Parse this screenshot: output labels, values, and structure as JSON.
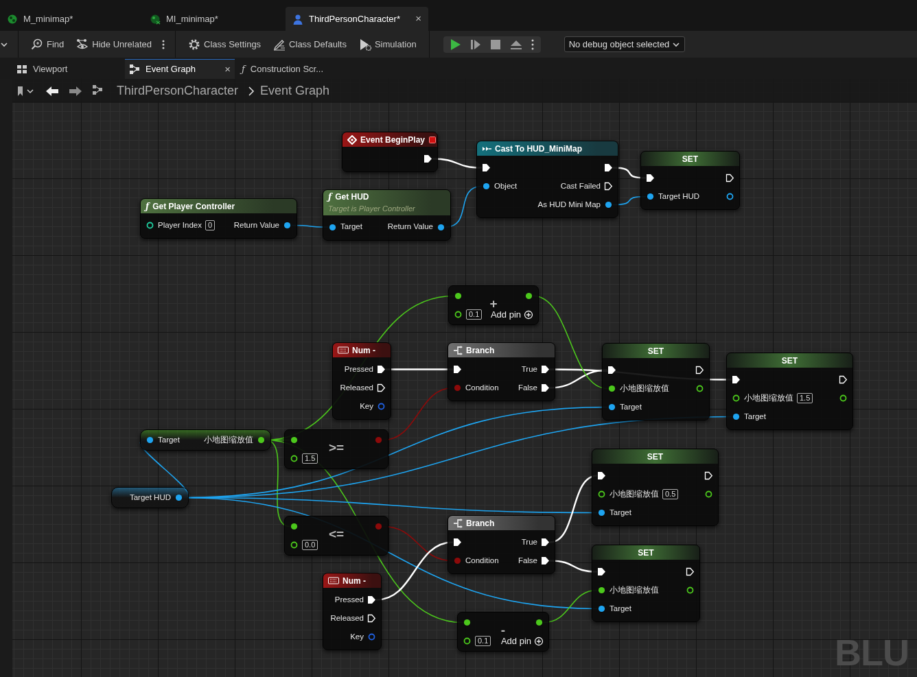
{
  "file_tabs": [
    {
      "label": "M_minimap*",
      "kind": "material",
      "selected": false
    },
    {
      "label": "MI_minimap*",
      "kind": "instance",
      "selected": false
    },
    {
      "label": "ThirdPersonCharacter*",
      "kind": "character",
      "selected": true,
      "close": "×"
    }
  ],
  "toolbar": {
    "items": [
      {
        "kind": "menu"
      },
      {
        "kind": "separator"
      },
      {
        "kind": "find",
        "label": "Find"
      },
      {
        "kind": "hide",
        "label": "Hide Unrelated"
      },
      {
        "kind": "more"
      },
      {
        "kind": "separator"
      },
      {
        "kind": "settings",
        "label": "Class Settings"
      },
      {
        "kind": "defaults",
        "label": "Class Defaults"
      },
      {
        "kind": "simulation",
        "label": "Simulation"
      },
      {
        "kind": "separator"
      }
    ],
    "debug_select": "No debug object selected"
  },
  "editor_tabs": [
    {
      "label": "Viewport",
      "kind": "viewport",
      "selected": false
    },
    {
      "label": "Event Graph",
      "kind": "graph",
      "selected": true,
      "close": "×"
    },
    {
      "label": "Construction Scr...",
      "kind": "function",
      "glyph": "ƒ",
      "selected": false
    }
  ],
  "breadcrumb": [
    "ThirdPersonCharacter",
    "Event Graph"
  ],
  "nodes": [
    {
      "kind": "event",
      "title": "Event BeginPlay",
      "rows": [
        {
          "right": {
            "kind": "exec",
            "connected": true
          }
        }
      ]
    },
    {
      "kind": "cast",
      "title": "Cast To HUD_MiniMap",
      "rows": [
        {
          "left": {
            "kind": "exec",
            "connected": true
          },
          "right": {
            "kind": "exec",
            "connected": true
          }
        },
        {
          "left": {
            "kind": "object",
            "label": "Object",
            "connected": true
          },
          "right": {
            "kind": "exec",
            "label": "Cast Failed",
            "connected": false
          }
        },
        {
          "right": {
            "kind": "object",
            "label": "As HUD Mini Map",
            "connected": true
          }
        }
      ]
    },
    {
      "kind": "set",
      "title": "SET",
      "rows": [
        {
          "left": {
            "kind": "exec",
            "connected": true
          },
          "right": {
            "kind": "exec",
            "connected": false
          }
        },
        {
          "left": {
            "kind": "object",
            "label": "Target HUD",
            "connected": true
          },
          "right": {
            "kind": "object",
            "connected": false
          }
        }
      ]
    },
    {
      "kind": "pure",
      "glyph": "ƒ",
      "title": "Get Player Controller",
      "rows": [
        {
          "left": {
            "kind": "int",
            "label": "Player Index",
            "value": "0",
            "connected": false
          },
          "right": {
            "kind": "object",
            "label": "Return Value",
            "connected": true
          }
        }
      ]
    },
    {
      "kind": "pure",
      "glyph": "ƒ",
      "title": "Get HUD",
      "subtitle": "Target is Player Controller",
      "rows": [
        {
          "left": {
            "kind": "object",
            "label": "Target",
            "connected": true
          },
          "right": {
            "kind": "object",
            "label": "Return Value",
            "connected": true
          }
        }
      ]
    },
    {
      "kind": "math",
      "operator": "+",
      "add_pin": "Add pin",
      "rows": [
        {
          "left": {
            "kind": "float",
            "connected": true
          },
          "right": {
            "kind": "float",
            "connected": true
          }
        },
        {
          "left": {
            "kind": "float",
            "value": "0.1",
            "connected": false
          }
        }
      ]
    },
    {
      "kind": "input",
      "title": "Num -",
      "rows": [
        {
          "right": {
            "kind": "exec",
            "label": "Pressed",
            "connected": true
          }
        },
        {
          "right": {
            "kind": "exec",
            "label": "Released",
            "connected": false
          }
        },
        {
          "right": {
            "kind": "struct",
            "label": "Key",
            "connected": false
          }
        }
      ]
    },
    {
      "kind": "branch",
      "title": "Branch",
      "rows": [
        {
          "left": {
            "kind": "exec",
            "connected": true
          },
          "right": {
            "kind": "exec",
            "label": "True",
            "connected": true
          }
        },
        {
          "left": {
            "kind": "bool",
            "label": "Condition",
            "connected": true
          },
          "right": {
            "kind": "exec",
            "label": "False",
            "connected": true
          }
        }
      ]
    },
    {
      "kind": "set",
      "title": "SET",
      "rows": [
        {
          "left": {
            "kind": "exec",
            "connected": true
          },
          "right": {
            "kind": "exec",
            "connected": false
          }
        },
        {
          "left": {
            "kind": "float",
            "label": "小地图缩放值",
            "connected": true
          },
          "right": {
            "kind": "float",
            "connected": false
          }
        },
        {
          "left": {
            "kind": "object",
            "label": "Target",
            "connected": true
          }
        }
      ]
    },
    {
      "kind": "set",
      "title": "SET",
      "rows": [
        {
          "left": {
            "kind": "exec",
            "connected": true
          },
          "right": {
            "kind": "exec",
            "connected": false
          }
        },
        {
          "left": {
            "kind": "float",
            "label": "小地图缩放值",
            "value": "1.5",
            "connected": false
          },
          "right": {
            "kind": "float",
            "connected": false
          }
        },
        {
          "left": {
            "kind": "object",
            "label": "Target",
            "connected": true
          }
        }
      ]
    },
    {
      "kind": "variable",
      "rows": [
        {
          "left": {
            "kind": "object",
            "label": "Target",
            "connected": true
          },
          "right": {
            "kind": "float",
            "label": "小地图缩放值",
            "connected": true
          }
        }
      ]
    },
    {
      "kind": "math",
      "operator": ">=",
      "rows": [
        {
          "left": {
            "kind": "float",
            "connected": true
          },
          "right": {
            "kind": "bool",
            "connected": true
          }
        },
        {
          "left": {
            "kind": "float",
            "value": "1.5",
            "connected": false
          }
        }
      ]
    },
    {
      "kind": "variable",
      "rows": [
        {
          "right": {
            "kind": "object",
            "label": "Target HUD",
            "connected": true
          }
        }
      ]
    },
    {
      "kind": "set",
      "title": "SET",
      "rows": [
        {
          "left": {
            "kind": "exec",
            "connected": true
          },
          "right": {
            "kind": "exec",
            "connected": false
          }
        },
        {
          "left": {
            "kind": "float",
            "label": "小地图缩放值",
            "value": "0.5",
            "connected": false
          },
          "right": {
            "kind": "float",
            "connected": false
          }
        },
        {
          "left": {
            "kind": "object",
            "label": "Target",
            "connected": true
          }
        }
      ]
    },
    {
      "kind": "math",
      "operator": "<=",
      "rows": [
        {
          "left": {
            "kind": "float",
            "connected": true
          },
          "right": {
            "kind": "bool",
            "connected": true
          }
        },
        {
          "left": {
            "kind": "float",
            "value": "0.0",
            "connected": false
          }
        }
      ]
    },
    {
      "kind": "branch",
      "title": "Branch",
      "rows": [
        {
          "left": {
            "kind": "exec",
            "connected": true
          },
          "right": {
            "kind": "exec",
            "label": "True",
            "connected": true
          }
        },
        {
          "left": {
            "kind": "bool",
            "label": "Condition",
            "connected": true
          },
          "right": {
            "kind": "exec",
            "label": "False",
            "connected": true
          }
        }
      ]
    },
    {
      "kind": "set",
      "title": "SET",
      "rows": [
        {
          "left": {
            "kind": "exec",
            "connected": true
          },
          "right": {
            "kind": "exec",
            "connected": false
          }
        },
        {
          "left": {
            "kind": "float",
            "label": "小地图缩放值",
            "connected": true
          },
          "right": {
            "kind": "float",
            "connected": false
          }
        },
        {
          "left": {
            "kind": "object",
            "label": "Target",
            "connected": true
          }
        }
      ]
    },
    {
      "kind": "input",
      "title": "Num -",
      "rows": [
        {
          "right": {
            "kind": "exec",
            "label": "Pressed",
            "connected": true
          }
        },
        {
          "right": {
            "kind": "exec",
            "label": "Released",
            "connected": false
          }
        },
        {
          "right": {
            "kind": "struct",
            "label": "Key",
            "connected": false
          }
        }
      ]
    },
    {
      "kind": "math",
      "operator": "-",
      "add_pin": "Add pin",
      "rows": [
        {
          "left": {
            "kind": "float",
            "connected": true
          },
          "right": {
            "kind": "float",
            "connected": true
          }
        },
        {
          "left": {
            "kind": "float",
            "value": "0.1",
            "connected": false
          }
        }
      ]
    }
  ],
  "corner_label": "BLU"
}
